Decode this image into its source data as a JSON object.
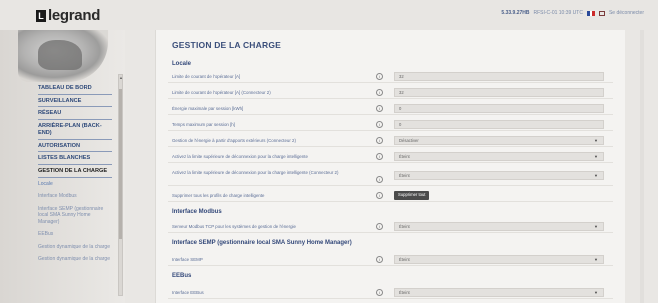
{
  "header": {
    "logo_box": "L",
    "logo_text": "legrand",
    "serial": "5.33.9.27HB",
    "status": "RFSI-C-01 10:39 UTC",
    "logout_label": "Se déconnecter",
    "flag_colors": [
      "#2a4a9a",
      "#ffffff",
      "#cc2a2a"
    ]
  },
  "nav": {
    "items": [
      {
        "label": "TABLEAU DE BORD"
      },
      {
        "label": "SURVEILLANCE"
      },
      {
        "label": "RÉSEAU"
      },
      {
        "label": "ARRIÈRE-PLAN (BACK-END)"
      },
      {
        "label": "AUTORISATION"
      },
      {
        "label": "LISTES BLANCHES"
      },
      {
        "label": "GESTION DE LA CHARGE"
      }
    ],
    "subitems": [
      {
        "label": "Locale"
      },
      {
        "label": "Interface Modbus"
      },
      {
        "label": "Interface SEMP (gestionnaire local SMA Sunny Home Manager)"
      },
      {
        "label": "EEBus"
      },
      {
        "label": "Gestion dynamique de la charge"
      },
      {
        "label": "Gestion dynamique de la charge"
      }
    ]
  },
  "main": {
    "title": "GESTION DE LA CHARGE",
    "sections": {
      "locale": "Locale",
      "modbus": "Interface Modbus",
      "semp": "Interface SEMP (gestionnaire local SMA Sunny Home Manager)",
      "eebus": "EEBus"
    },
    "help_glyph": "i",
    "caret": "▼",
    "rows": [
      {
        "label": "Limite de courant de l'opérateur [A]",
        "value": "32"
      },
      {
        "label": "Limite de courant de l'opérateur [A] (Connecteur 2)",
        "value": "32"
      },
      {
        "label": "Énergie maximale par session [kWh]",
        "value": "0"
      },
      {
        "label": "Temps maximum par session [h]",
        "value": "0"
      },
      {
        "label": "Gestion de l'énergie à partir d'apports extérieurs (Connecteur 2)",
        "value": "Désactiver"
      },
      {
        "label": "Activez la limite supérieure de déconnexion pour la charge intelligente",
        "value": "Éteint"
      },
      {
        "label": "Activez la limite supérieure de déconnexion pour la charge intelligente (Connecteur 2)",
        "value": "Éteint"
      },
      {
        "label": "Supprimer tous les profils de charge intelligente",
        "value": "Supprimer tout"
      },
      {
        "label": "Serveur Modbus TCP pour les systèmes de gestion de l'énergie",
        "value": "Éteint"
      },
      {
        "label": "Interface SEMP",
        "value": "Éteint"
      },
      {
        "label": "Interface EEBus",
        "value": "Éteint"
      }
    ]
  }
}
